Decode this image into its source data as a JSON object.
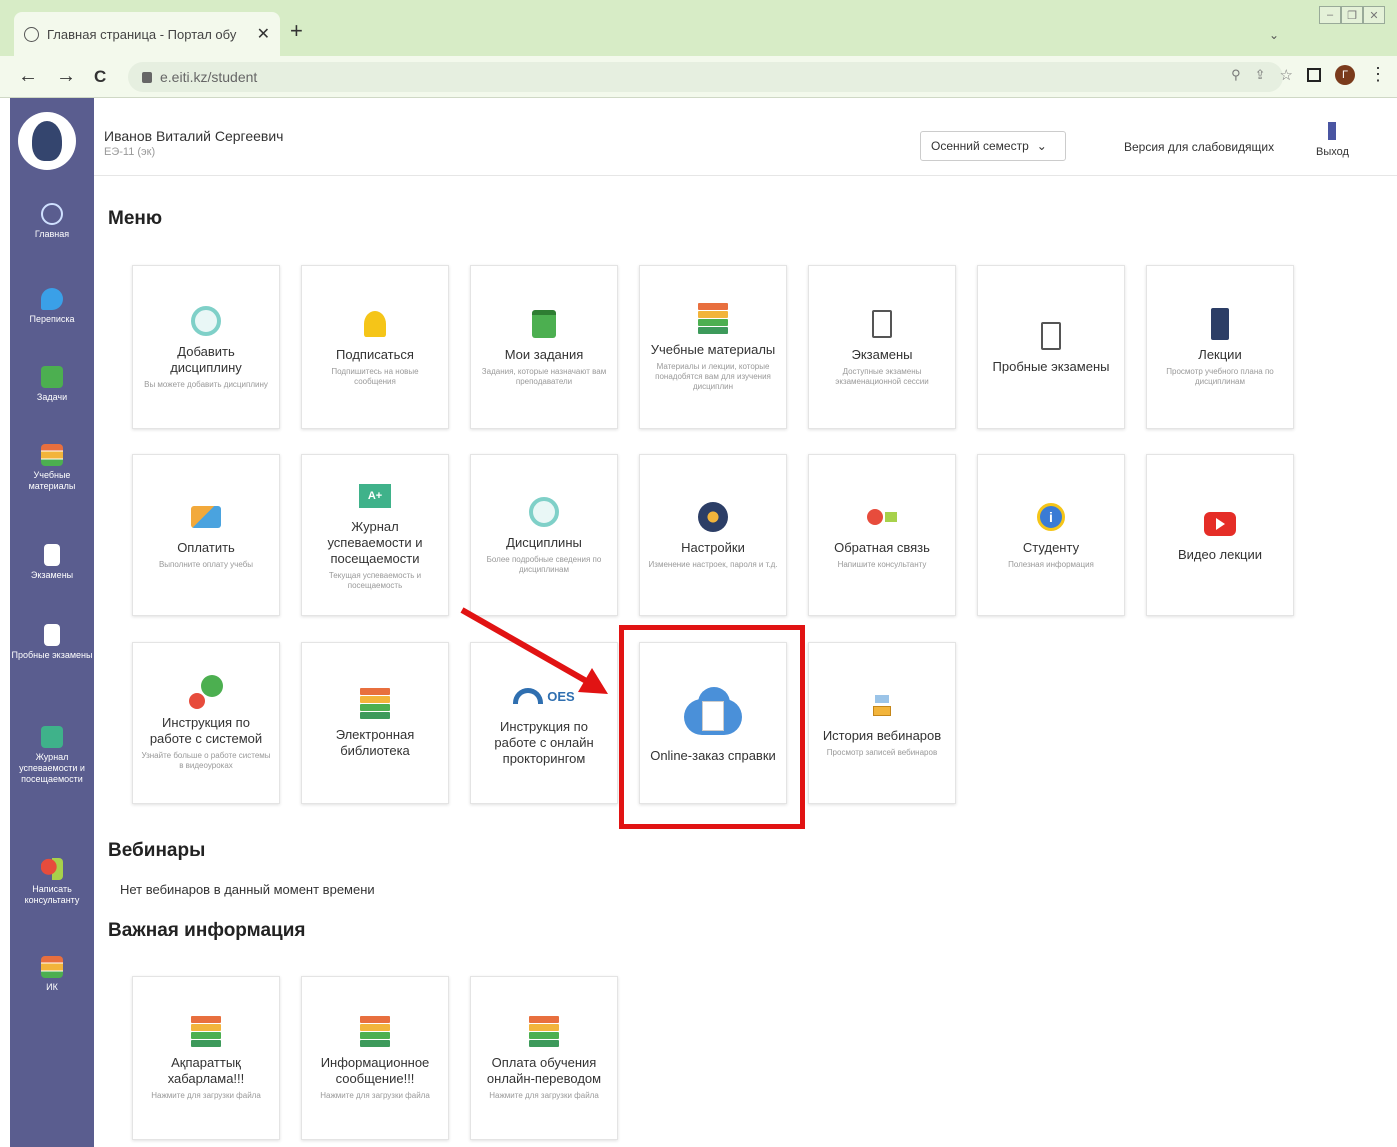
{
  "browser": {
    "tab_title": "Главная страница - Портал обу",
    "tab_close": "✕",
    "new_tab": "+",
    "url": "e.eiti.kz/student",
    "back": "←",
    "forward": "→",
    "reload": "C",
    "profile_letter": "Г",
    "menu": "⋮"
  },
  "header": {
    "user_name": "Иванов Виталий Сергеевич",
    "user_group": "ЕЭ-11 (эк)",
    "semester": "Осенний семестр",
    "low_vision": "Версия для слабовидящих",
    "exit": "Выход"
  },
  "sidebar": {
    "items": [
      {
        "label": "Главная",
        "icon": "atom-icon"
      },
      {
        "label": "Переписка",
        "icon": "chat-icon"
      },
      {
        "label": "Задачи",
        "icon": "tasks-icon"
      },
      {
        "label": "Учебные материалы",
        "icon": "books-icon"
      },
      {
        "label": "Экзамены",
        "icon": "clipboard-icon"
      },
      {
        "label": "Пробные экзамены",
        "icon": "clipboard-icon"
      },
      {
        "label": "Журнал успеваемости и посещаемости",
        "icon": "grade-icon"
      },
      {
        "label": "Написать консультанту",
        "icon": "consultant-icon"
      },
      {
        "label": "ИК",
        "icon": "books-icon"
      }
    ]
  },
  "sections": {
    "menu": "Меню",
    "webinars": "Вебинары",
    "webinars_empty": "Нет вебинаров в данный момент времени",
    "important": "Важная информация"
  },
  "menu_cards": [
    {
      "title": "Добавить дисциплину",
      "desc": "Вы можете добавить дисциплину",
      "icon": "clock-icon"
    },
    {
      "title": "Подписаться",
      "desc": "Подпишитесь на новые сообщения",
      "icon": "bell-icon"
    },
    {
      "title": "Мои задания",
      "desc": "Задания, которые назначают вам преподаватели",
      "icon": "tasks-icon"
    },
    {
      "title": "Учебные материалы",
      "desc": "Материалы и лекции, которые понадобятся вам для изучения дисциплин",
      "icon": "books-icon"
    },
    {
      "title": "Экзамены",
      "desc": "Доступные экзамены экзаменационной сессии",
      "icon": "clipboard-icon"
    },
    {
      "title": "Пробные экзамены",
      "desc": "",
      "icon": "clipboard-icon"
    },
    {
      "title": "Лекции",
      "desc": "Просмотр учебного плана по дисциплинам",
      "icon": "phone-icon"
    },
    {
      "title": "Оплатить",
      "desc": "Выполните оплату учебы",
      "icon": "payment-icon"
    },
    {
      "title": "Журнал успеваемости и посещаемости",
      "desc": "Текущая успеваемость и посещаемость",
      "icon": "grade-icon"
    },
    {
      "title": "Дисциплины",
      "desc": "Более подробные сведения по дисциплинам",
      "icon": "clock-icon"
    },
    {
      "title": "Настройки",
      "desc": "Изменение настроек, пароля и т.д.",
      "icon": "settings-icon"
    },
    {
      "title": "Обратная связь",
      "desc": "Напишите консультанту",
      "icon": "feedback-icon"
    },
    {
      "title": "Студенту",
      "desc": "Полезная информация",
      "icon": "info-icon"
    },
    {
      "title": "Видео лекции",
      "desc": "",
      "icon": "youtube-icon"
    },
    {
      "title": "Инструкция по работе с системой",
      "desc": "Узнайте больше о работе системы в видеоуроках",
      "icon": "instruction-icon"
    },
    {
      "title": "Электронная библиотека",
      "desc": "",
      "icon": "books-icon"
    },
    {
      "title": "Инструкция по работе с онлайн прокторингом",
      "desc": "",
      "icon": "oes-logo-icon",
      "logo_text": "OES"
    },
    {
      "title": "Online-заказ справки",
      "desc": "",
      "icon": "cloud-document-icon"
    },
    {
      "title": "История вебинаров",
      "desc": "Просмотр записей вебинаров",
      "icon": "webinar-history-icon"
    }
  ],
  "info_cards": [
    {
      "title": "Ақпараттық хабарлама!!!",
      "desc": "Нажмите для загрузки файла",
      "icon": "books-icon"
    },
    {
      "title": "Информационное сообщение!!!",
      "desc": "Нажмите для загрузки файла",
      "icon": "books-icon"
    },
    {
      "title": "Оплата обучения онлайн-переводом",
      "desc": "Нажмите для загрузки файла",
      "icon": "books-icon"
    }
  ],
  "colors": {
    "sidebar": "#5a5d8f",
    "highlight": "#e11313",
    "tabbar": "#d7ecc6"
  }
}
